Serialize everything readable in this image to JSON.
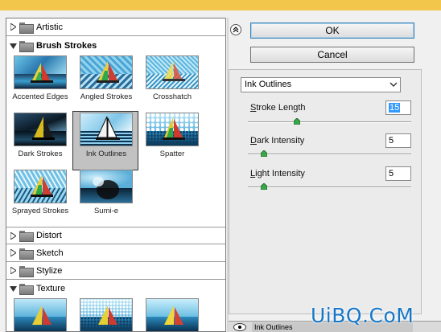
{
  "categories": [
    {
      "label": "Artistic",
      "open": false
    },
    {
      "label": "Brush Strokes",
      "open": true
    },
    {
      "label": "Distort",
      "open": false
    },
    {
      "label": "Sketch",
      "open": false
    },
    {
      "label": "Stylize",
      "open": false
    },
    {
      "label": "Texture",
      "open": true
    }
  ],
  "brush_filters": [
    {
      "label": "Accented Edges",
      "selected": false
    },
    {
      "label": "Angled Strokes",
      "selected": false
    },
    {
      "label": "Crosshatch",
      "selected": false
    },
    {
      "label": "Dark Strokes",
      "selected": false
    },
    {
      "label": "Ink Outlines",
      "selected": true
    },
    {
      "label": "Spatter",
      "selected": false
    },
    {
      "label": "Sprayed Strokes",
      "selected": false
    },
    {
      "label": "Sumi-e",
      "selected": false
    }
  ],
  "buttons": {
    "ok": "OK",
    "cancel": "Cancel"
  },
  "settings": {
    "filter_select": "Ink Outlines",
    "stroke_length": {
      "prefix": "",
      "accel": "S",
      "rest": "troke Length",
      "value": "15",
      "level": 0.3
    },
    "dark_intensity": {
      "accel": "D",
      "rest": "ark Intensity",
      "value": "5",
      "level": 0.1
    },
    "light_intensity": {
      "accel": "L",
      "rest": "ight Intensity",
      "value": "5",
      "level": 0.1
    }
  },
  "layer_strip": {
    "label": "Ink Outlines"
  },
  "watermark": "UiBQ.CoM",
  "colors": {
    "accent": "#3399ff",
    "topbar": "#f2c64a",
    "watermark": "#1677c8"
  },
  "icons": {
    "collapse": "double-chevron-up-icon",
    "expand_arrow": "triangle-right-icon",
    "collapse_arrow": "triangle-down-icon",
    "folder": "folder-icon",
    "visibility": "eye-icon"
  }
}
